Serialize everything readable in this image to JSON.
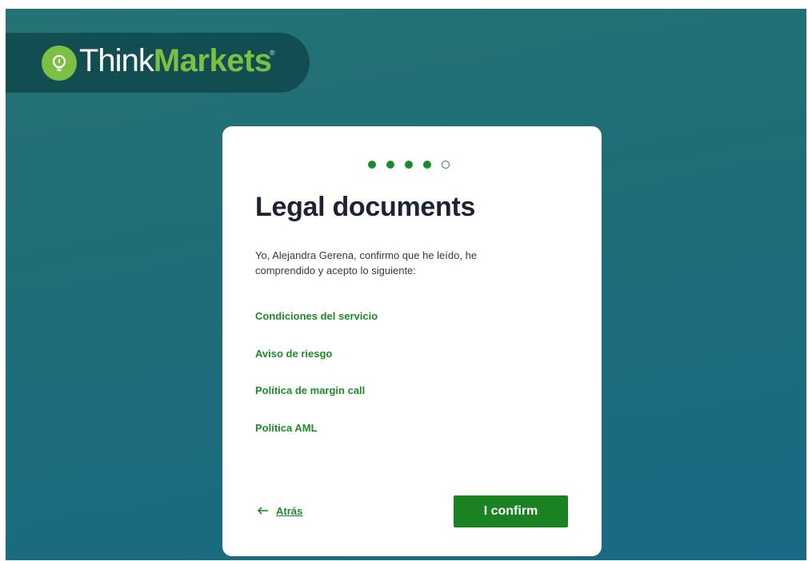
{
  "brand": {
    "name_part1": "Think",
    "name_part2": "Markets",
    "registered_mark": "®",
    "icon": "lightbulb-icon",
    "accent_color": "#7bc043"
  },
  "progress": {
    "total_steps": 5,
    "completed_steps": 4
  },
  "card": {
    "title": "Legal documents",
    "intro": "Yo, Alejandra Gerena, confirmo que he leído, he comprendido y acepto lo siguiente:",
    "documents": [
      "Condiciones del servicio",
      "Aviso de riesgo",
      "Política de margin call",
      "Política AML"
    ]
  },
  "actions": {
    "back_label": "Atrás",
    "back_icon": "arrow-left-icon",
    "confirm_label": "I confirm"
  },
  "colors": {
    "primary_green": "#1b8224",
    "link_green": "#1f8a2b",
    "background_teal": "#1e6d78"
  }
}
